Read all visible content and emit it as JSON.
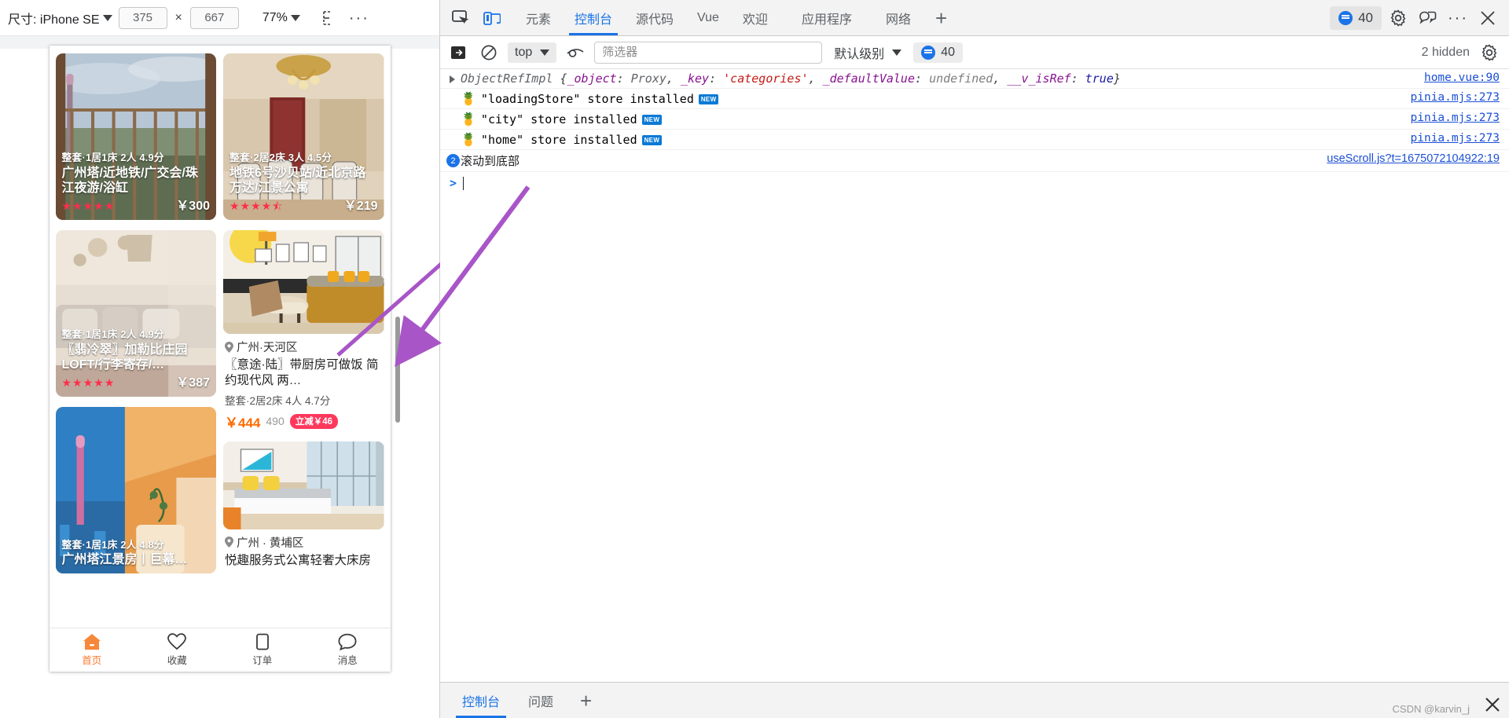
{
  "device_toolbar": {
    "size_label": "尺寸: iPhone SE",
    "width_value": "375",
    "times": "×",
    "height_value": "667",
    "zoom_value": "77%",
    "throttle_icon": "throttling-icon",
    "more_icon": "more-options-icon"
  },
  "phone": {
    "listings": [
      {
        "id": "card-1",
        "meta": "整套·1居1床 2人 4.9分",
        "title": "广州塔/近地铁/广交会/珠江夜游/浴缸",
        "stars": "★★★★★",
        "price": "￥300",
        "overlay": true
      },
      {
        "id": "card-2",
        "meta": "整套·2居2床 3人 4.5分",
        "title": "地铁6号沙贝站/近北京路万达/江景公寓",
        "stars": "★★★★⯪",
        "price": "￥219",
        "overlay": true
      },
      {
        "id": "card-3",
        "meta": "整套·1居1床 2人 4.9分",
        "title": "〖翡冷翠〗加勒比庄园LOFT/行李寄存/…",
        "stars": "★★★★★",
        "price": "￥387",
        "overlay": true
      },
      {
        "id": "card-4",
        "location": "广州·天河区",
        "title": "〖意途·陆〗带厨房可做饭 简约现代风 两…",
        "meta": "整套·2居2床 4人 4.7分",
        "price_now": "￥444",
        "price_old": "490",
        "badge": "立减￥46",
        "overlay": false
      },
      {
        "id": "card-5",
        "meta": "整套·1居1床 2人 4.8分",
        "title": "广州塔江景房丨巨幕…",
        "overlay": true
      },
      {
        "id": "card-6",
        "location": "广州 · 黄埔区",
        "title": "悦趣服务式公寓轻奢大床房",
        "overlay": false
      }
    ],
    "tabbar": [
      {
        "icon": "home-icon",
        "label": "首页",
        "active": true
      },
      {
        "icon": "heart-icon",
        "label": "收藏",
        "active": false
      },
      {
        "icon": "order-icon",
        "label": "订单",
        "active": false
      },
      {
        "icon": "message-icon",
        "label": "消息",
        "active": false
      }
    ]
  },
  "devtools": {
    "inspect_icon": "inspect-element-icon",
    "device_toggle_icon": "device-toolbar-icon",
    "tabs": [
      {
        "label": "元素",
        "selected": false
      },
      {
        "label": "控制台",
        "selected": true
      },
      {
        "label": "源代码",
        "selected": false
      },
      {
        "label": "Vue",
        "selected": false
      },
      {
        "label": "欢迎",
        "selected": false
      },
      {
        "label": "应用程序",
        "selected": false
      },
      {
        "label": "网络",
        "selected": false
      }
    ],
    "add_tab": "+",
    "issues_count": "40",
    "settings_icon": "gear-icon",
    "feedback_icon": "feedback-icon",
    "more_icon": "more-options-icon",
    "close_icon": "close-icon"
  },
  "console_toolbar": {
    "sidebar_icon": "console-sidebar-icon",
    "clear_icon": "clear-console-icon",
    "context": "top",
    "eye_icon": "live-expression-icon",
    "filter_placeholder": "筛选器",
    "filter_value": "",
    "level": "默认级别",
    "issues_count": "40",
    "hidden_text": "2 hidden",
    "settings_icon": "console-settings-icon"
  },
  "console_logs": [
    {
      "type": "object",
      "expandable": true,
      "name": "ObjectRefImpl",
      "brace_open": "{",
      "parts": [
        {
          "key": "_object",
          "sep": ": ",
          "value": "Proxy",
          "kind": "name"
        },
        {
          "key": "_key",
          "sep": ": ",
          "value": "'categories'",
          "kind": "string"
        },
        {
          "key": "_defaultValue",
          "sep": ": ",
          "value": "undefined",
          "kind": "undefined"
        },
        {
          "key": "__v_isRef",
          "sep": ": ",
          "value": "true",
          "kind": "bool"
        }
      ],
      "brace_close": "}",
      "source": "home.vue:90"
    },
    {
      "type": "pinia",
      "emoji": "🍍",
      "text": "\"loadingStore\" store installed",
      "badge": "NEW",
      "source": "pinia.mjs:273"
    },
    {
      "type": "pinia",
      "emoji": "🍍",
      "text": "\"city\" store installed",
      "badge": "NEW",
      "source": "pinia.mjs:273"
    },
    {
      "type": "pinia",
      "emoji": "🍍",
      "text": "\"home\" store installed",
      "badge": "NEW",
      "source": "pinia.mjs:273"
    },
    {
      "type": "counted",
      "count": "2",
      "text": "滚动到底部",
      "source": "useScroll.js?t=1675072104922:19"
    }
  ],
  "console_prompt": {
    "arrow": ">",
    "value": ""
  },
  "console_footer": {
    "tabs": [
      {
        "label": "控制台",
        "selected": true
      },
      {
        "label": "问题",
        "selected": false
      }
    ],
    "add_tab": "+",
    "watermark": "CSDN @karvin_j",
    "close_icon": "close-drawer-icon"
  },
  "colors": {
    "accent_blue": "#1a73e8",
    "link_blue": "#1a4fd6",
    "brand_orange": "#ff7a2f",
    "price_orange": "#ff6a00",
    "badge_red": "#ff385c",
    "annotation_purple": "#a855c8"
  }
}
